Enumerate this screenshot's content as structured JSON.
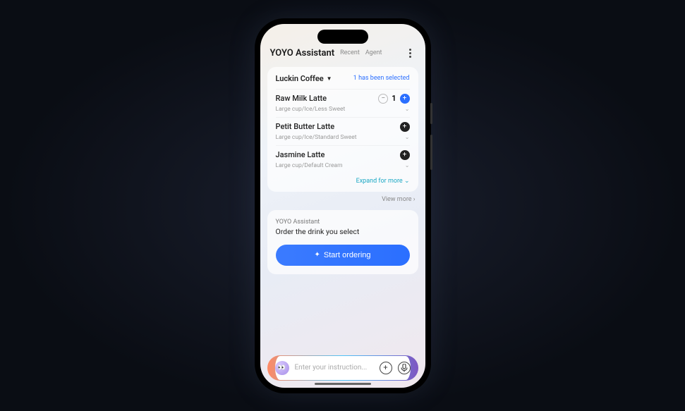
{
  "header": {
    "title": "YOYO Assistant",
    "tabs": [
      "Recent",
      "Agent"
    ]
  },
  "order_card": {
    "vendor": "Luckin Coffee",
    "selected_note": "1 has been selected",
    "items": [
      {
        "name": "Raw Milk Latte",
        "options": "Large cup/Ice/Less Sweet",
        "qty": 1,
        "has_qty": true
      },
      {
        "name": "Petit Butter Latte",
        "options": "Large cup/Ice/Standard Sweet",
        "has_qty": false
      },
      {
        "name": "Jasmine Latte",
        "options": "Large cup/Default Cream",
        "has_qty": false
      }
    ],
    "expand_label": "Expand for more",
    "view_more_label": "View more"
  },
  "assistant_card": {
    "name": "YOYO Assistant",
    "message": "Order the drink you select",
    "button_label": "Start ordering"
  },
  "input": {
    "placeholder": "Enter your instruction...",
    "avatar_emoji": "👀"
  }
}
